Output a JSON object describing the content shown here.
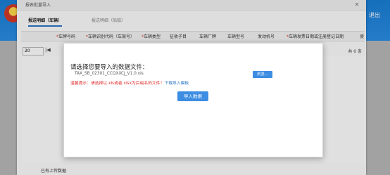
{
  "app": {
    "logout_label": "退出"
  },
  "window": {
    "title": "报表批量导入",
    "close_glyph": "✕",
    "tabs": [
      {
        "label": "报送明细（车辆）"
      },
      {
        "label": "报送明细（船舶）"
      }
    ],
    "columns": [
      {
        "label": "车牌号码",
        "required": true
      },
      {
        "label": "车辆识别代码（车架号）",
        "required": true
      },
      {
        "label": "车辆类型",
        "required": true
      },
      {
        "label": "征收子目",
        "required": false
      },
      {
        "label": "车辆厂牌",
        "required": false
      },
      {
        "label": "车辆型号",
        "required": false
      },
      {
        "label": "发动机号",
        "required": false
      },
      {
        "label": "车辆发票日期或注册登记日期",
        "required": true
      },
      {
        "label": "使",
        "required": false
      }
    ],
    "pager": {
      "page_size": "20",
      "first_glyph": "|◀",
      "info": "共 0 条"
    },
    "footer_text": "已有上传数据"
  },
  "dialog": {
    "title": "请选择您要导入的数据文件：",
    "filename": "TAX_SB_02301_CCQXXCJ_V1.0.xls",
    "browse_label": "浏览...",
    "tip_prefix": "温馨提示：请选择以.xls或者.xlsx为后缀名的文件！",
    "tip_link": "下载导入模板",
    "import_label": "导入数据"
  }
}
